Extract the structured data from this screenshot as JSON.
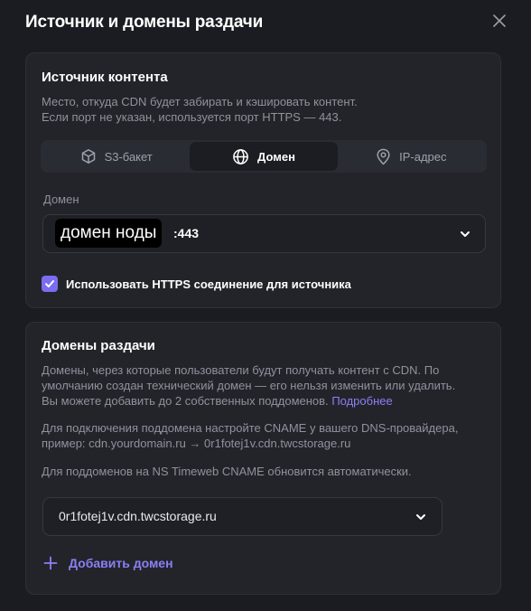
{
  "modal": {
    "title": "Источник и домены раздачи"
  },
  "source": {
    "title": "Источник контента",
    "description": [
      "Место, откуда CDN будет забирать и кэшировать контент.",
      "Если порт не указан, используется порт HTTPS — 443."
    ],
    "tabs": [
      {
        "label": "S3-бакет",
        "icon": "cube-icon",
        "active": false
      },
      {
        "label": "Домен",
        "icon": "globe-icon",
        "active": true
      },
      {
        "label": "IP-адрес",
        "icon": "location-pin-icon",
        "active": false
      }
    ],
    "domain_label": "Домен",
    "domain_value_masked": "домен ноды",
    "domain_value_suffix": ":443",
    "https_checkbox_label": "Использовать HTTPS соединение для источника",
    "https_checked": true
  },
  "domains": {
    "title": "Домены раздачи",
    "description": [
      "Домены, через которые пользователи будут получать контент с CDN. По",
      "умолчанию создан технический домен — его нельзя изменить или удалить.",
      "Вы можете добавить до 2 собственных поддоменов."
    ],
    "more_link": "Подробнее",
    "cname_hint": [
      "Для подключения поддомена настройте CNAME у вашего DNS-провайдера,",
      "пример: cdn.yourdomain.ru → 0r1fotej1v.cdn.twcstorage.ru"
    ],
    "ns_hint": "Для поддоменов на NS Timeweb CNAME обновится автоматически.",
    "domain_select_value": "0r1fotej1v.cdn.twcstorage.ru",
    "add_button_label": "Добавить домен"
  },
  "colors": {
    "background": "#1b1c21",
    "card": "#23242a",
    "accent": "#7b6df2",
    "link": "#8b7ff5",
    "muted_text": "#8f929c"
  }
}
